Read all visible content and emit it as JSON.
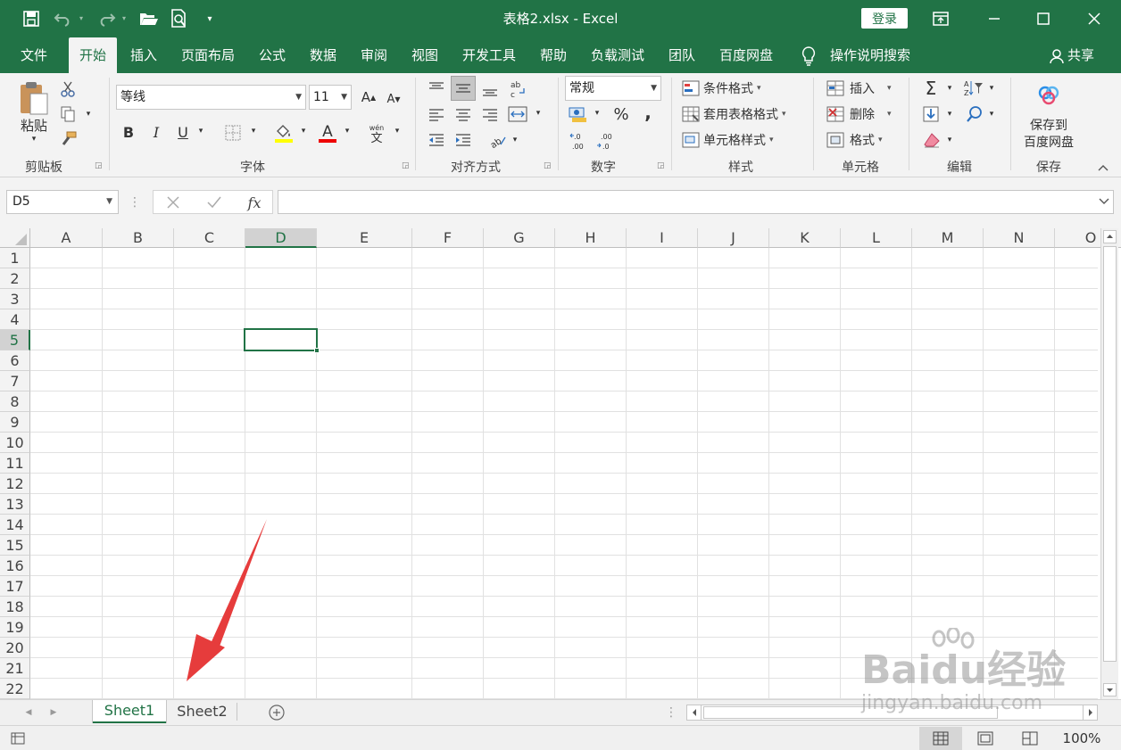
{
  "titlebar": {
    "title": "表格2.xlsx  -  Excel",
    "login": "登录"
  },
  "tabs": [
    "文件",
    "开始",
    "插入",
    "页面布局",
    "公式",
    "数据",
    "审阅",
    "视图",
    "开发工具",
    "帮助",
    "负载测试",
    "团队",
    "百度网盘"
  ],
  "tell_me": "操作说明搜索",
  "share": "共享",
  "ribbon": {
    "clipboard": {
      "paste": "粘贴",
      "group": "剪贴板"
    },
    "font": {
      "name": "等线",
      "size": "11",
      "bold": "B",
      "italic": "I",
      "underline": "U",
      "group": "字体"
    },
    "alignment": {
      "group": "对齐方式"
    },
    "number": {
      "format": "常规",
      "percent": "%",
      "comma": ",",
      "group": "数字"
    },
    "styles": {
      "conditional": "条件格式",
      "table": "套用表格格式",
      "cell_styles": "单元格样式",
      "group": "样式"
    },
    "cells": {
      "insert": "插入",
      "delete": "删除",
      "format": "格式",
      "group": "单元格"
    },
    "editing": {
      "group": "编辑"
    },
    "save": {
      "label_line1": "保存到",
      "label_line2": "百度网盘",
      "group": "保存"
    }
  },
  "formula_bar": {
    "name_box": "D5",
    "fx": "fx",
    "value": ""
  },
  "columns": [
    "A",
    "B",
    "C",
    "D",
    "E",
    "F",
    "G",
    "H",
    "I",
    "J",
    "K",
    "L",
    "M",
    "N",
    "O"
  ],
  "rows": [
    "1",
    "2",
    "3",
    "4",
    "5",
    "6",
    "7",
    "8",
    "9",
    "10",
    "11",
    "12",
    "13",
    "14",
    "15",
    "16",
    "17",
    "18",
    "19",
    "20",
    "21",
    "22"
  ],
  "selected_cell": "D5",
  "sheets": [
    "Sheet1",
    "Sheet2"
  ],
  "active_sheet": "Sheet1",
  "status": {
    "zoom": "100%"
  },
  "watermark": {
    "line1": "Baidu经验",
    "line2": "jingyan.baidu.com"
  },
  "colors": {
    "accent": "#217346",
    "arrow": "#e63c3c"
  }
}
